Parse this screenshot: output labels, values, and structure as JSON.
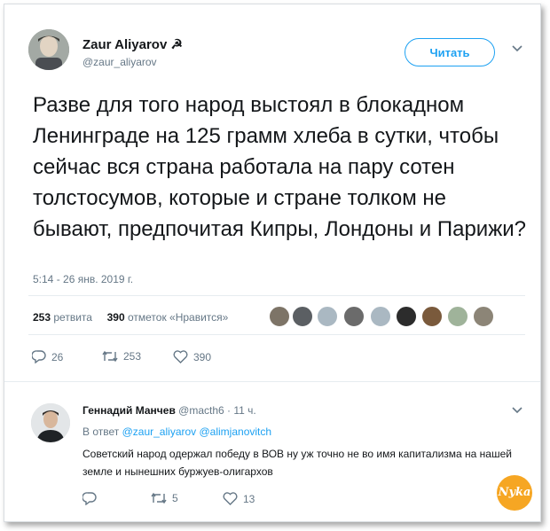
{
  "tweet": {
    "author_name": "Zaur Aliyarov ☭",
    "handle": "@zaur_aliyarov",
    "follow_label": "Читать",
    "text": "Разве для того народ выстоял в блокадном Ленинграде на 125 грамм хлеба в сутки, чтобы сейчас вся страна работала на пару сотен толстосумов, которые и стране толком не бывают, предпочитая Кипры, Лондоны и Парижи?",
    "timestamp": "5:14 - 26 янв. 2019 г.",
    "retweets_count": "253",
    "retweets_label": "ретвита",
    "likes_count": "390",
    "likes_label": "отметок «Нравится»",
    "actions": {
      "replies": "26",
      "retweets": "253",
      "likes": "390"
    }
  },
  "reply": {
    "author_name": "Геннадий Манчев",
    "meta": "@macth6 · 11 ч.",
    "in_reply_prefix": "В ответ",
    "in_reply_users": "@zaur_aliyarov @alimjanovitch",
    "text": "Советский народ одержал победу в ВОВ ну уж точно не во имя капитализма на нашей земле и нынешних буржуев-олигархов",
    "actions": {
      "replies": "",
      "retweets": "5",
      "likes": "13"
    }
  },
  "watermark": "Nyka",
  "icons": [
    "chevron-down-icon",
    "reply-icon",
    "retweet-icon",
    "heart-icon"
  ],
  "colors": {
    "accent": "#1da1f2",
    "text": "#14171a",
    "muted": "#657786",
    "divider": "#e6ecf0",
    "watermark": "#f6a623"
  }
}
